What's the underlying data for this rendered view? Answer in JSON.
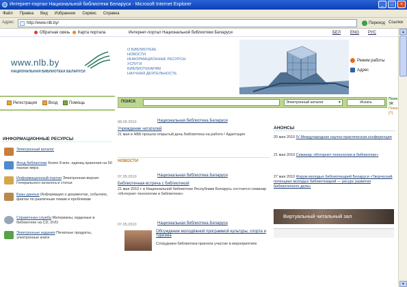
{
  "window": {
    "title": "Интернет-портал Национальной библиотеки Беларуси - Microsoft Internet Explorer",
    "btn_min": "_",
    "btn_max": "□",
    "btn_close": "×"
  },
  "menu": [
    "Файл",
    "Правка",
    "Вид",
    "Избранное",
    "Сервис",
    "Справка"
  ],
  "address": {
    "label": "Адрес",
    "value": "http://www.nlb.by/",
    "go": "Переход",
    "links": "Ссылки"
  },
  "topnav": {
    "feedback": "Обратная связь",
    "sitemap": "Карта портала",
    "portal": "Интернет-портал Национальной библиотеки Беларуси",
    "langs": [
      "БЕЛ",
      "ENG",
      "РУС"
    ]
  },
  "logo": {
    "url": "www.nlb.by",
    "subtitle": "НАЦИОНАЛЬНАЯ БИБЛИОТЕКА БЕЛАРУСИ"
  },
  "mainmenu": [
    "О БИБЛИОТЕКЕ",
    "НОВОСТИ",
    "ИНФОРМАЦИОННЫЕ РЕСУРСЫ",
    "УСЛУГИ",
    "БИБЛИОТЕКАРЯМ",
    "НАУЧНАЯ ДЕЯТЕЛЬНОСТЬ"
  ],
  "rightlinks": {
    "hours": "Режим работы",
    "address": "Адрес"
  },
  "auth": {
    "register": "Регистрация",
    "login": "Вход",
    "help": "Помощь"
  },
  "search": {
    "label": "ПОИСК",
    "select": "Электронный каталог",
    "button": "Искать",
    "ek": "Поиск в ЭК",
    "help": "Помощь [?]"
  },
  "leftcol": {
    "title": "ИНФОРМАЦИОННЫЕ РЕСУРСЫ",
    "items": [
      {
        "link": "Электронный каталог",
        "text": ""
      },
      {
        "link": "Фонд библиотеки",
        "text": " более 8 млн. единиц хранения на 50 языках мира"
      },
      {
        "link": "Информационный портал",
        "text": " Электронная версия Генерального каталога и статьи"
      },
      {
        "link": "Базы данных",
        "text": " Информация о документах, событиях, фактах по различным темам и проблемам"
      },
      {
        "link": "Справочная служба",
        "text": " Материалы, изданные в библиотеке на CD, DVD"
      },
      {
        "link": "Электронные издания",
        "text": " Печатные продукты, электронные книги"
      }
    ]
  },
  "news": {
    "items": [
      {
        "date": "08.05.2010",
        "source": "Национальная библиотека Беларуси",
        "title": "Учреждение читателей",
        "text": "21 мая в НББ прошла открытый день Библиотека на работе / Адаптация"
      },
      {
        "date": "07.05.2010",
        "source": "Национальная библиотека Беларуси",
        "title": "Библиотечная встреча с библиотекой",
        "text": "21 мая 2010 г. в Национальной библиотеке Республики Беларусь состоится семинар «Интернет-технологии в библиотеке»"
      },
      {
        "date": "07.05.2010",
        "source": "Национальная библиотека Беларуси",
        "title": "Обсуждение молодёжной программой культуры, спорта и туризма",
        "text": "Сотрудники библиотеки приняли участие в мероприятиях"
      }
    ],
    "label": "НОВОСТИ"
  },
  "announcements": {
    "title": "АНОНСЫ",
    "items": [
      {
        "date": "20 мая 2010",
        "title": "IV Международная научно-практическая конференция"
      },
      {
        "date": "21 мая 2010",
        "title": "Семинар «Интернет-технологии в библиотеке»"
      },
      {
        "date": "27 мая 2010",
        "title": "Форум молодых библиотекарей Беларуси «Творческий потенциал молодых библиотекарей — ресурс развития библиотечного дела»"
      }
    ],
    "virtual_hall": "Виртуальный читальный зал"
  }
}
